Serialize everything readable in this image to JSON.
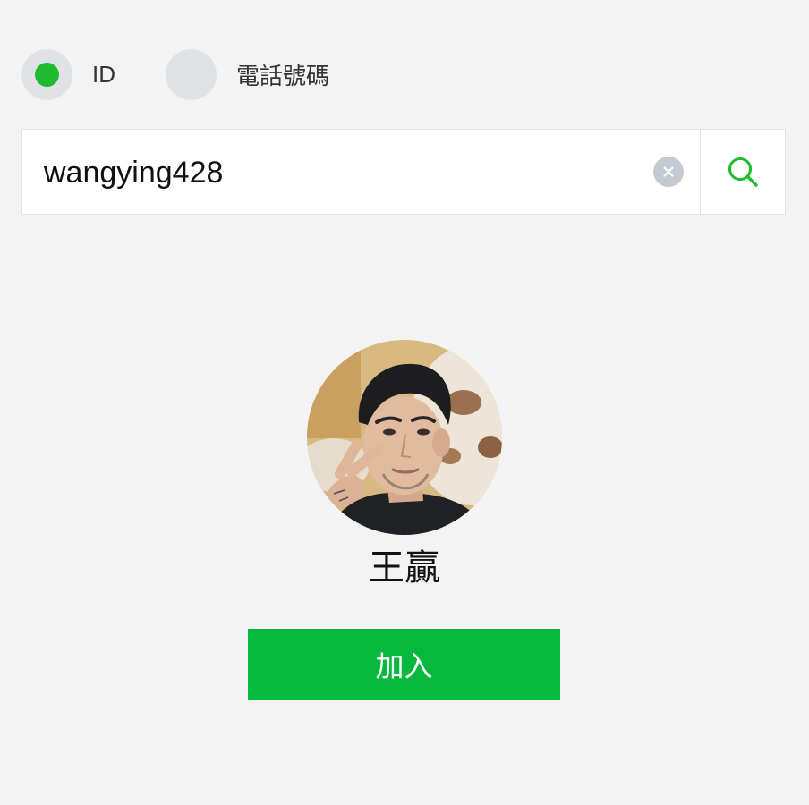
{
  "search_type": {
    "options": [
      {
        "label": "ID",
        "selected": true
      },
      {
        "label": "電話號碼",
        "selected": false
      }
    ],
    "selected_color": "#1fbb2e"
  },
  "search": {
    "value": "wangying428",
    "clear_icon": "clear-circle-x-icon",
    "search_icon": "magnifier-icon",
    "search_icon_color": "#1fbb2e"
  },
  "profile": {
    "name": "王贏",
    "avatar": "profile-photo"
  },
  "actions": {
    "add_label": "加入",
    "add_color": "#06b83b"
  }
}
